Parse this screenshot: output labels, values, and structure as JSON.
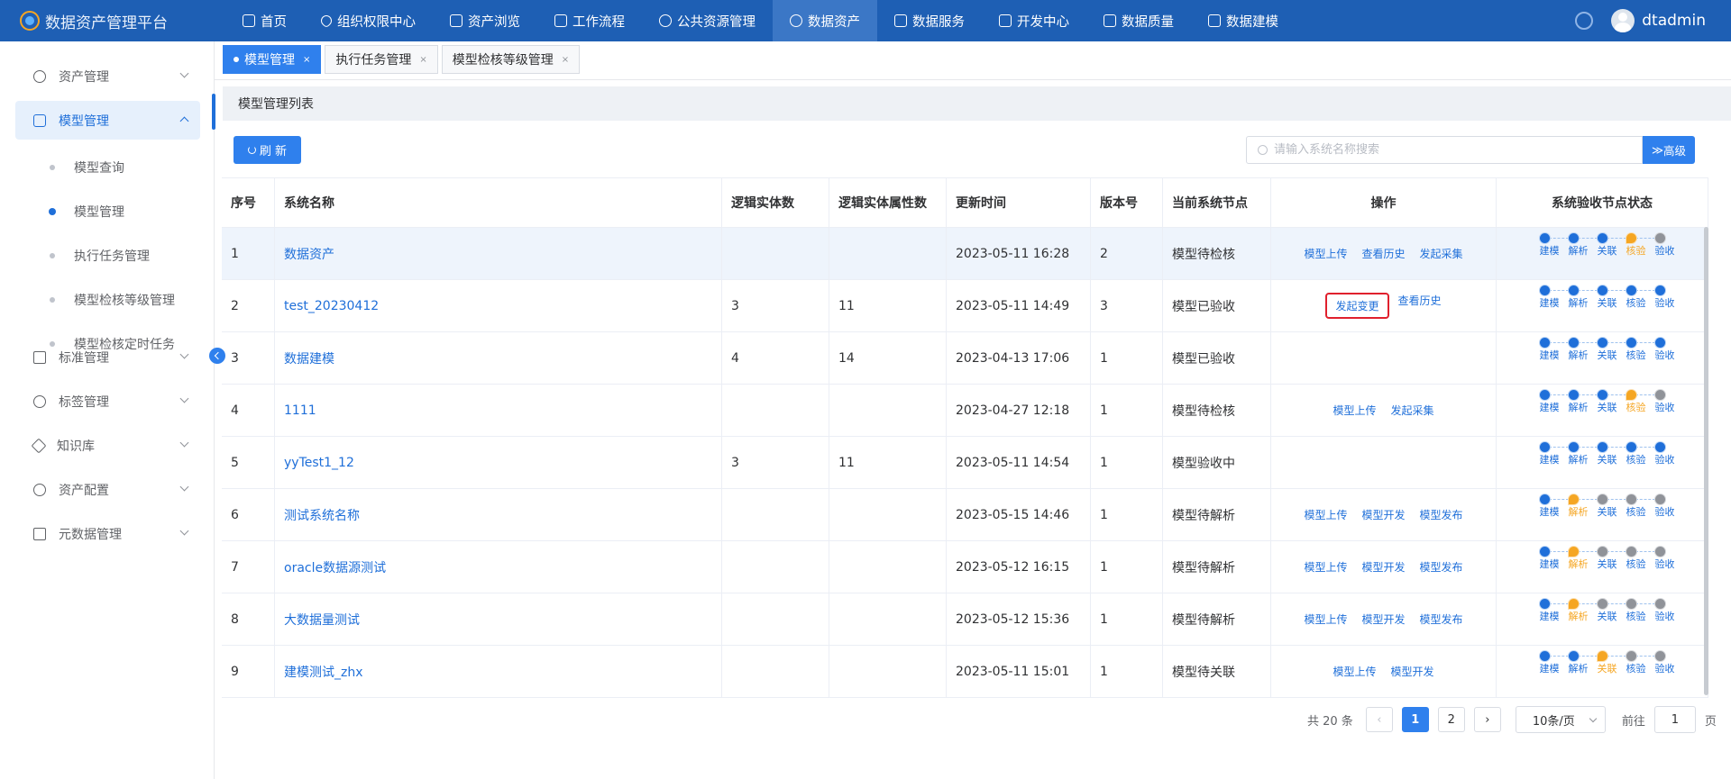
{
  "app": {
    "title": "数据资产管理平台",
    "user": "dtadmin"
  },
  "nav": [
    {
      "label": "首页",
      "icon": "document-icon"
    },
    {
      "label": "组织权限中心",
      "icon": "heart-icon"
    },
    {
      "label": "资产浏览",
      "icon": "list-icon"
    },
    {
      "label": "工作流程",
      "icon": "scale-icon"
    },
    {
      "label": "公共资源管理",
      "icon": "people-icon"
    },
    {
      "label": "数据资产",
      "icon": "database-icon",
      "active": true
    },
    {
      "label": "数据服务",
      "icon": "chart-icon"
    },
    {
      "label": "开发中心",
      "icon": "edit-icon"
    },
    {
      "label": "数据质量",
      "icon": "bar-chart-icon"
    },
    {
      "label": "数据建模",
      "icon": "layers-icon"
    }
  ],
  "sidebar": {
    "items": [
      {
        "label": "资产管理",
        "icon": "clock-icon"
      },
      {
        "label": "模型管理",
        "icon": "line-chart-icon",
        "active": true
      },
      {
        "label": "标准管理",
        "icon": "document-icon"
      },
      {
        "label": "标签管理",
        "icon": "plus-circle-icon"
      },
      {
        "label": "知识库",
        "icon": "tag-icon"
      },
      {
        "label": "资产配置",
        "icon": "target-icon"
      },
      {
        "label": "元数据管理",
        "icon": "layers-icon"
      }
    ],
    "sub_items": [
      {
        "label": "模型查询"
      },
      {
        "label": "模型管理",
        "active": true
      },
      {
        "label": "执行任务管理"
      },
      {
        "label": "模型检核等级管理"
      },
      {
        "label": "模型检核定时任务"
      }
    ]
  },
  "tabs": [
    {
      "label": "模型管理",
      "close": "×",
      "active": true
    },
    {
      "label": "执行任务管理",
      "close": "×"
    },
    {
      "label": "模型检核等级管理",
      "close": "×"
    }
  ],
  "panel": {
    "title": "模型管理列表",
    "refresh_label": "刷 新",
    "search_placeholder": "请输入系统名称搜索",
    "advanced_label": "高级"
  },
  "table": {
    "headers": [
      "序号",
      "系统名称",
      "逻辑实体数",
      "逻辑实体属性数",
      "更新时间",
      "版本号",
      "当前系统节点",
      "操作",
      "系统验收节点状态"
    ],
    "step_labels": [
      "建模",
      "解析",
      "关联",
      "核验",
      "验收"
    ],
    "rows": [
      {
        "no": "1",
        "name": "数据资产",
        "entities": "",
        "attrs": "",
        "updated": "2023-05-11 16:28",
        "version": "2",
        "node": "模型待检核",
        "ops": [
          "模型上传",
          "查看历史",
          "发起采集"
        ],
        "steps": [
          "done",
          "done",
          "done",
          "cur",
          "todo"
        ],
        "highlight": true
      },
      {
        "no": "2",
        "name": "test_20230412",
        "entities": "3",
        "attrs": "11",
        "updated": "2023-05-11 14:49",
        "version": "3",
        "node": "模型已验收",
        "ops": [
          "发起变更",
          "查看历史"
        ],
        "boxed_op": 0,
        "steps": [
          "done",
          "done",
          "done",
          "done",
          "done"
        ]
      },
      {
        "no": "3",
        "name": "数据建模",
        "entities": "4",
        "attrs": "14",
        "updated": "2023-04-13 17:06",
        "version": "1",
        "node": "模型已验收",
        "ops": [],
        "steps": [
          "done",
          "done",
          "done",
          "done",
          "done"
        ]
      },
      {
        "no": "4",
        "name": "1111",
        "entities": "",
        "attrs": "",
        "updated": "2023-04-27 12:18",
        "version": "1",
        "node": "模型待检核",
        "ops": [
          "模型上传",
          "发起采集"
        ],
        "steps": [
          "done",
          "done",
          "done",
          "cur",
          "todo"
        ]
      },
      {
        "no": "5",
        "name": "yyTest1_12",
        "entities": "3",
        "attrs": "11",
        "updated": "2023-05-11 14:54",
        "version": "1",
        "node": "模型验收中",
        "ops": [],
        "steps": [
          "done",
          "done",
          "done",
          "done",
          "done"
        ]
      },
      {
        "no": "6",
        "name": "测试系统名称",
        "entities": "",
        "attrs": "",
        "updated": "2023-05-15 14:46",
        "version": "1",
        "node": "模型待解析",
        "ops": [
          "模型上传",
          "模型开发",
          "模型发布"
        ],
        "steps": [
          "done",
          "cur",
          "todo",
          "todo",
          "todo"
        ]
      },
      {
        "no": "7",
        "name": "oracle数据源测试",
        "entities": "",
        "attrs": "",
        "updated": "2023-05-12 16:15",
        "version": "1",
        "node": "模型待解析",
        "ops": [
          "模型上传",
          "模型开发",
          "模型发布"
        ],
        "steps": [
          "done",
          "cur",
          "todo",
          "todo",
          "todo"
        ]
      },
      {
        "no": "8",
        "name": "大数据量测试",
        "entities": "",
        "attrs": "",
        "updated": "2023-05-12 15:36",
        "version": "1",
        "node": "模型待解析",
        "ops": [
          "模型上传",
          "模型开发",
          "模型发布"
        ],
        "steps": [
          "done",
          "cur",
          "todo",
          "todo",
          "todo"
        ]
      },
      {
        "no": "9",
        "name": "建模测试_zhx",
        "entities": "",
        "attrs": "",
        "updated": "2023-05-11 15:01",
        "version": "1",
        "node": "模型待关联",
        "ops": [
          "模型上传",
          "模型开发"
        ],
        "steps": [
          "done",
          "done",
          "cur",
          "todo",
          "todo"
        ]
      }
    ]
  },
  "pagination": {
    "total": "共 20 条",
    "pages": [
      "1",
      "2"
    ],
    "current": "1",
    "page_size": "10条/页",
    "goto_prefix": "前往",
    "goto_value": "1",
    "goto_suffix": "页"
  }
}
